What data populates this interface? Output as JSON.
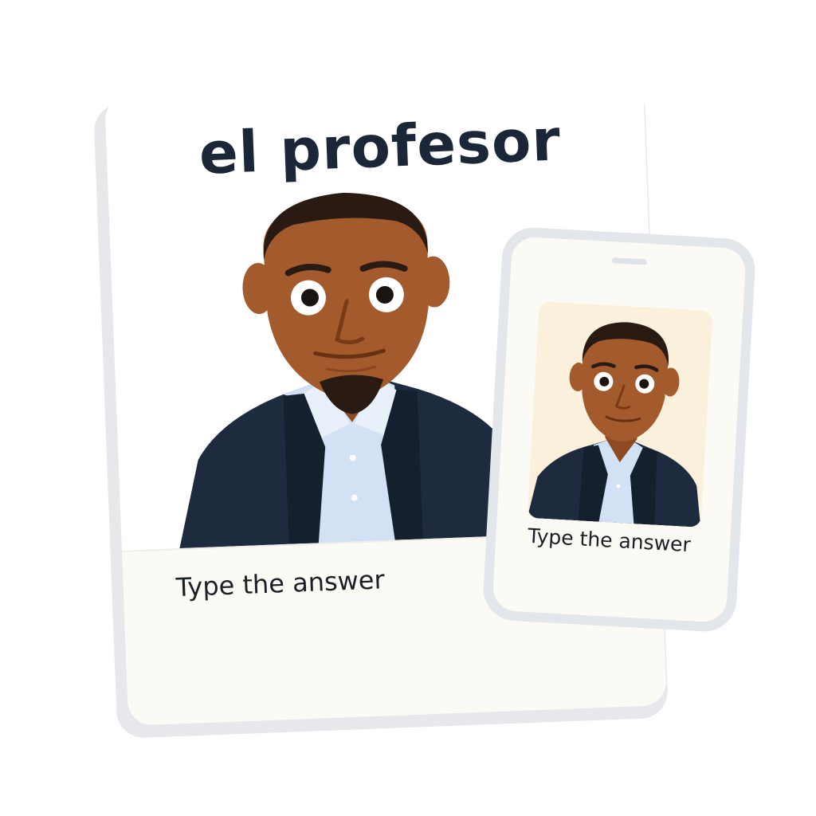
{
  "flashcard": {
    "word": "el profesor",
    "prompt": "Type the answer",
    "image_icon": "teacher-portrait-illustration"
  },
  "phone": {
    "prompt": "Type the answer",
    "image_icon": "teacher-portrait-illustration"
  },
  "colors": {
    "word_text": "#1b2637",
    "card_background": "#ffffff",
    "answer_area_background": "#fbfaf4",
    "phone_frame": "#e3e6ea",
    "phone_photo_background": "#fbf0dc",
    "skin": "#a35a2c",
    "hair": "#2a1a14",
    "blazer": "#1e2a3d",
    "shirt": "#d3e1f4"
  }
}
